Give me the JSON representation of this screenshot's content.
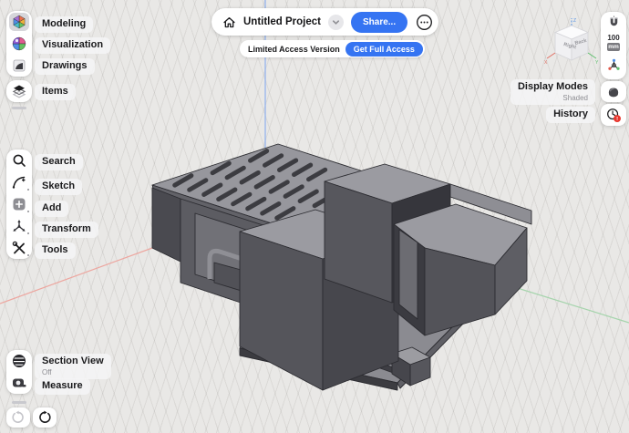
{
  "topbar": {
    "title": "Untitled Project",
    "share": "Share...",
    "limited_access": "Limited Access Version",
    "get_full_access": "Get Full Access"
  },
  "sidebar": {
    "workspaces": [
      {
        "label": "Modeling",
        "selected": true
      },
      {
        "label": "Visualization",
        "selected": false
      },
      {
        "label": "Drawings",
        "selected": false
      },
      {
        "label": "Items",
        "selected": false
      }
    ],
    "tools": [
      {
        "label": "Search"
      },
      {
        "label": "Sketch"
      },
      {
        "label": "Add"
      },
      {
        "label": "Transform"
      },
      {
        "label": "Tools"
      }
    ],
    "view_tools": [
      {
        "label": "Section View",
        "sublabel": "Off"
      },
      {
        "label": "Measure"
      }
    ]
  },
  "rightbar": {
    "grid_value": "100",
    "grid_unit": "mm",
    "display_modes": {
      "label": "Display Modes",
      "sublabel": "Shaded"
    },
    "history": {
      "label": "History",
      "badge": "!"
    }
  },
  "viewcube": {
    "face_left": "Right",
    "face_right": "Back",
    "axis_x": "X",
    "axis_y": "Y",
    "axis_z": "Z"
  },
  "colors": {
    "accent_blue": "#3574F2",
    "axis_x_red": "#EDA69F",
    "axis_y_green": "#A5D4AC",
    "axis_z_blue": "#8FB1EE",
    "badge_red": "#E8362D",
    "canvas_bg": "#E9E8E6"
  }
}
